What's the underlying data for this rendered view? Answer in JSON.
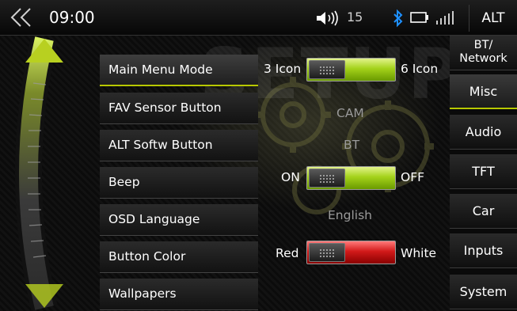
{
  "status_bar": {
    "time": "09:00",
    "volume_level": "15",
    "alt_label": "ALT",
    "icons": [
      "back-double-chevron-icon",
      "speaker-volume-icon",
      "bluetooth-icon",
      "battery-icon",
      "signal-bars-icon"
    ]
  },
  "background": {
    "watermark": "SETUP"
  },
  "menu": {
    "items": [
      {
        "label": "Main Menu Mode",
        "active": true
      },
      {
        "label": "FAV Sensor Button",
        "active": false
      },
      {
        "label": "ALT Softw Button",
        "active": false
      },
      {
        "label": "Beep",
        "active": false
      },
      {
        "label": "OSD Language",
        "active": false
      },
      {
        "label": "Button Color",
        "active": false
      },
      {
        "label": "Wallpapers",
        "active": false
      }
    ]
  },
  "options": {
    "main_menu_mode": {
      "left": "3 Icon",
      "right": "6 Icon",
      "selected": "6 Icon"
    },
    "fav_sensor_button": {
      "value": "CAM"
    },
    "alt_softw_button": {
      "value": "BT"
    },
    "beep": {
      "left": "ON",
      "right": "OFF",
      "selected": "OFF"
    },
    "osd_language": {
      "value": "English"
    },
    "button_color": {
      "left": "Red",
      "right": "White",
      "selected": "Red"
    }
  },
  "sidebar": {
    "tabs": [
      {
        "label": "BT/\nNetwork",
        "active": false
      },
      {
        "label": "Misc",
        "active": true
      },
      {
        "label": "Audio",
        "active": false
      },
      {
        "label": "TFT",
        "active": false
      },
      {
        "label": "Car",
        "active": false
      },
      {
        "label": "Inputs",
        "active": false
      },
      {
        "label": "System",
        "active": false
      }
    ]
  },
  "colors": {
    "accent_green": "#a4d21a",
    "toggle_red": "#d21a1a",
    "value_gray": "#9a9a9a"
  }
}
